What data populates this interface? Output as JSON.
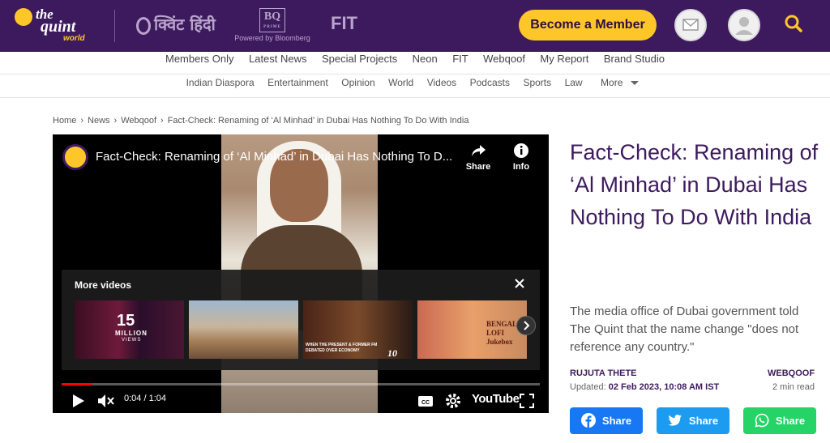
{
  "header": {
    "logo": {
      "the": "the",
      "quint": "quint",
      "world": "world"
    },
    "hindi_brand": "क्विंट हिंदी",
    "bq_brand": {
      "mark": "BQ",
      "sub": "PRIME",
      "powered": "Powered by Bloomberg"
    },
    "fit_brand": "FIT",
    "member_button": "Become a Member",
    "icons": [
      "mail-icon",
      "user-icon",
      "search-icon"
    ],
    "accent_color": "#ffc629",
    "bar_color": "#3d1a5e"
  },
  "nav_primary": [
    "Members Only",
    "Latest News",
    "Special Projects",
    "Neon",
    "FIT",
    "Webqoof",
    "My Report",
    "Brand Studio"
  ],
  "nav_secondary": [
    "Indian Diaspora",
    "Entertainment",
    "Opinion",
    "World",
    "Videos",
    "Podcasts",
    "Sports",
    "Law",
    "More"
  ],
  "breadcrumb": [
    "Home",
    "News",
    "Webqoof",
    "Fact-Check: Renaming of ‘Al Minhad’ in Dubai Has Nothing To Do With India"
  ],
  "video": {
    "title": "Fact-Check: Renaming of ‘Al Minhad’ in Dubai Has Nothing To D...",
    "share_label": "Share",
    "info_label": "Info",
    "more_videos_label": "More videos",
    "thumbs": {
      "t1": {
        "number": "15",
        "million": "MILLION",
        "views": "VIEWS"
      },
      "t3": {
        "caption": "WHEN THE PRESENT & FORMER FM DEBATED OVER ECONOMY",
        "badge": "10"
      },
      "t4": {
        "caption": "BENGALI LOFI Jukebox"
      }
    },
    "time": "0:04 / 1:04",
    "progress": 0.0625,
    "brand": "YouTube"
  },
  "article": {
    "headline": "Fact-Check: Renaming of ‘Al Minhad’ in Dubai Has Nothing To Do With India",
    "subhead": "The media office of Dubai government told The Quint that the name change \"does not reference any country.\"",
    "author": "RUJUTA THETE",
    "category": "WEBQOOF",
    "updated_label": "Updated:",
    "updated_value": "02 Feb 2023, 10:08 AM IST",
    "read_time": "2 min read",
    "share_buttons": [
      "Share",
      "Share",
      "Share"
    ]
  }
}
